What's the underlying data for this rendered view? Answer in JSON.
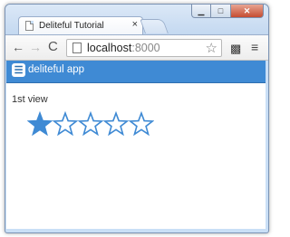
{
  "browser": {
    "tab_title": "Deliteful Tutorial",
    "tab_close_glyph": "×",
    "url_host": "localhost",
    "url_port": ":8000",
    "window_buttons": {
      "minimize": "▁",
      "maximize": "□",
      "close": "✕"
    }
  },
  "app": {
    "menu_glyph": "☰",
    "title": "deliteful app",
    "view_label": "1st view"
  },
  "rating": {
    "max": 5,
    "value": 1,
    "filled_color": "#3f8ad4",
    "empty_stroke_color": "#3f8ad4"
  },
  "icons": {
    "back": "←",
    "forward": "→",
    "reload": "C",
    "bookmark": "☆",
    "extension": "▩",
    "menu": "≡"
  }
}
